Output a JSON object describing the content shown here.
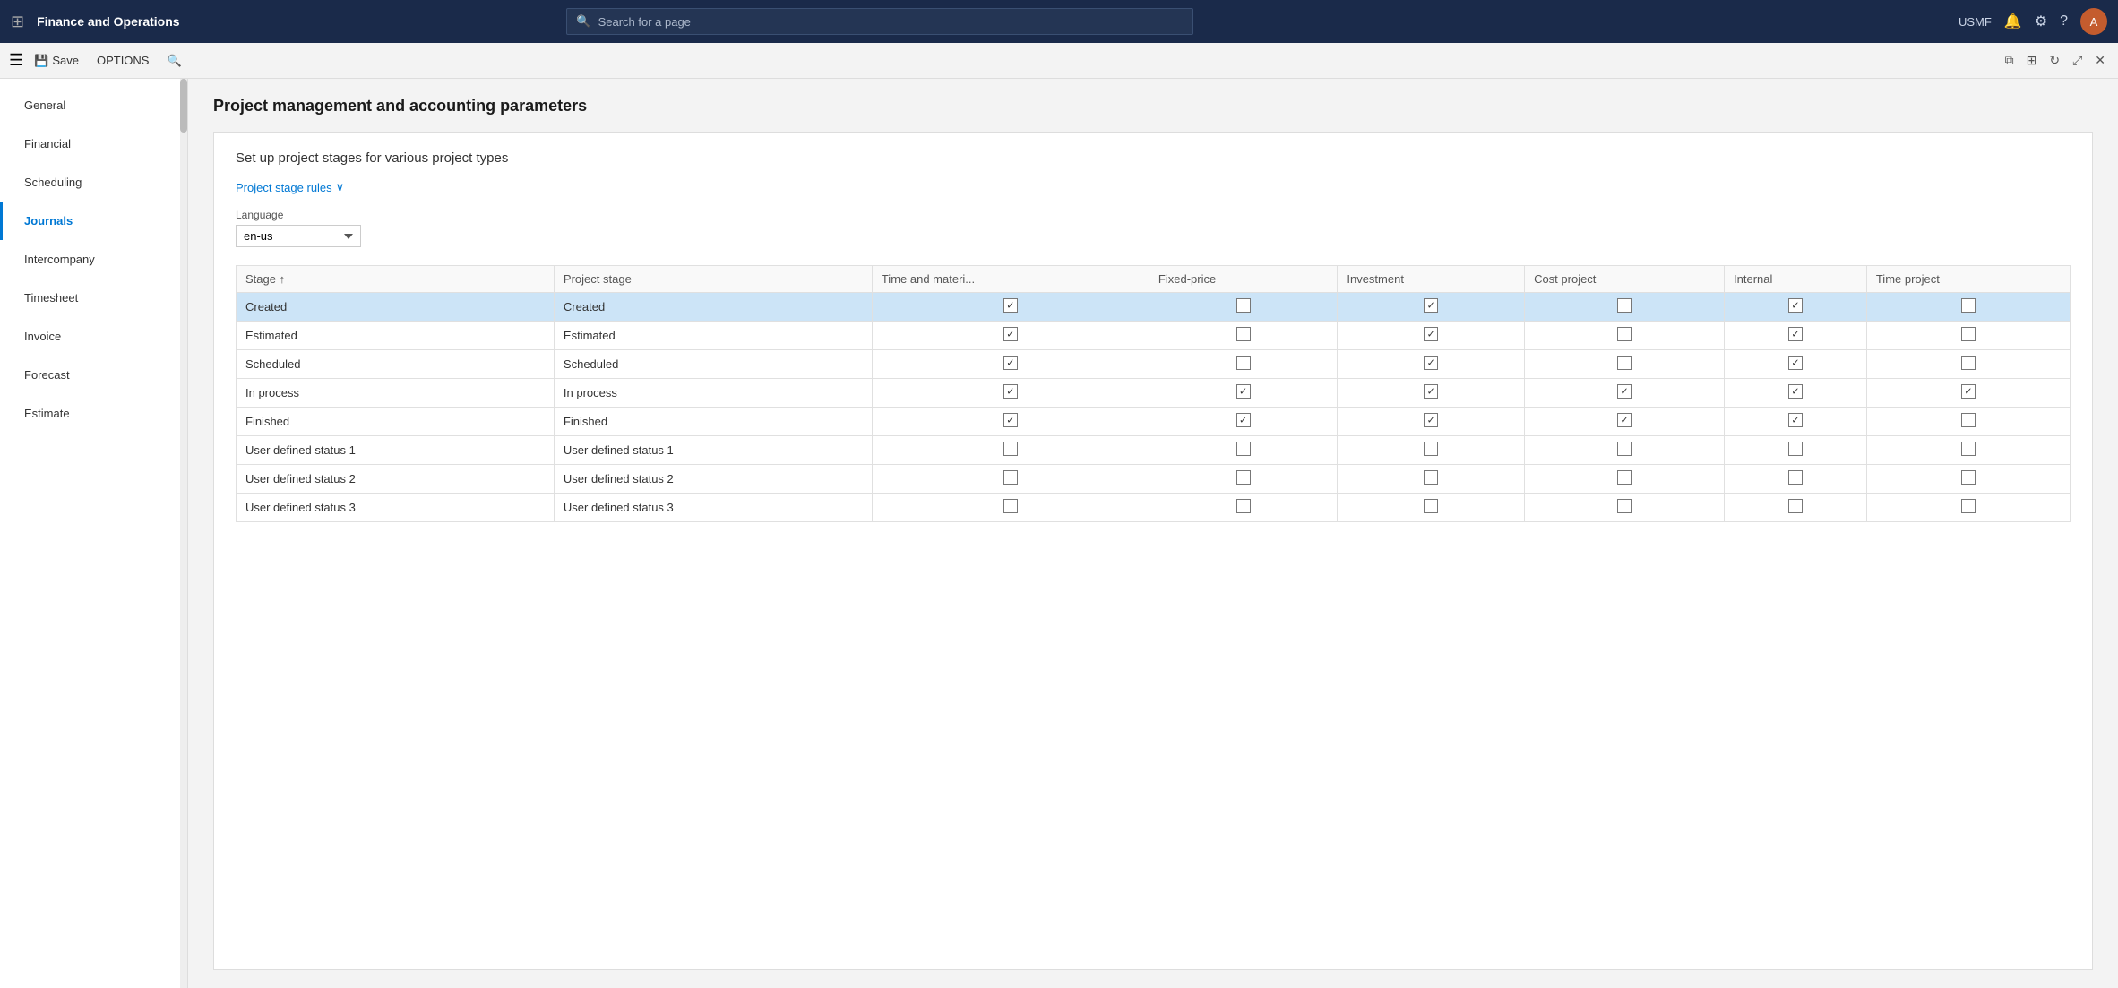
{
  "topnav": {
    "app_title": "Finance and Operations",
    "search_placeholder": "Search for a page",
    "user_label": "USMF"
  },
  "toolbar": {
    "save_label": "Save",
    "options_label": "OPTIONS"
  },
  "page": {
    "title": "Project management and accounting parameters"
  },
  "leftnav": {
    "items": [
      {
        "id": "general",
        "label": "General"
      },
      {
        "id": "financial",
        "label": "Financial"
      },
      {
        "id": "scheduling",
        "label": "Scheduling"
      },
      {
        "id": "journals",
        "label": "Journals"
      },
      {
        "id": "intercompany",
        "label": "Intercompany"
      },
      {
        "id": "timesheet",
        "label": "Timesheet"
      },
      {
        "id": "invoice",
        "label": "Invoice"
      },
      {
        "id": "forecast",
        "label": "Forecast"
      },
      {
        "id": "estimate",
        "label": "Estimate"
      }
    ]
  },
  "content": {
    "section_title": "Set up project stages for various project types",
    "project_stage_rules_label": "Project stage rules",
    "language_label": "Language",
    "language_value": "en-us",
    "table": {
      "columns": [
        {
          "id": "stage",
          "label": "Stage",
          "sort": true
        },
        {
          "id": "project_stage",
          "label": "Project stage"
        },
        {
          "id": "time_material",
          "label": "Time and materi..."
        },
        {
          "id": "fixed_price",
          "label": "Fixed-price"
        },
        {
          "id": "investment",
          "label": "Investment"
        },
        {
          "id": "cost_project",
          "label": "Cost project"
        },
        {
          "id": "internal",
          "label": "Internal"
        },
        {
          "id": "time_project",
          "label": "Time project"
        }
      ],
      "rows": [
        {
          "stage": "Created",
          "project_stage": "Created",
          "time_material": true,
          "fixed_price": false,
          "investment": true,
          "cost_project": false,
          "internal": true,
          "time_project": false,
          "selected": true
        },
        {
          "stage": "Estimated",
          "project_stage": "Estimated",
          "time_material": true,
          "fixed_price": false,
          "investment": true,
          "cost_project": false,
          "internal": true,
          "time_project": false,
          "selected": false
        },
        {
          "stage": "Scheduled",
          "project_stage": "Scheduled",
          "time_material": true,
          "fixed_price": false,
          "investment": true,
          "cost_project": false,
          "internal": true,
          "time_project": false,
          "selected": false
        },
        {
          "stage": "In process",
          "project_stage": "In process",
          "time_material": true,
          "fixed_price": true,
          "investment": true,
          "cost_project": true,
          "internal": true,
          "time_project": true,
          "selected": false
        },
        {
          "stage": "Finished",
          "project_stage": "Finished",
          "time_material": true,
          "fixed_price": true,
          "investment": true,
          "cost_project": true,
          "internal": true,
          "time_project": false,
          "selected": false
        },
        {
          "stage": "User defined status 1",
          "project_stage": "User defined status 1",
          "time_material": false,
          "fixed_price": false,
          "investment": false,
          "cost_project": false,
          "internal": false,
          "time_project": false,
          "selected": false
        },
        {
          "stage": "User defined status 2",
          "project_stage": "User defined status 2",
          "time_material": false,
          "fixed_price": false,
          "investment": false,
          "cost_project": false,
          "internal": false,
          "time_project": false,
          "selected": false
        },
        {
          "stage": "User defined status 3",
          "project_stage": "User defined status 3",
          "time_material": false,
          "fixed_price": false,
          "investment": false,
          "cost_project": false,
          "internal": false,
          "time_project": false,
          "selected": false
        }
      ]
    }
  }
}
